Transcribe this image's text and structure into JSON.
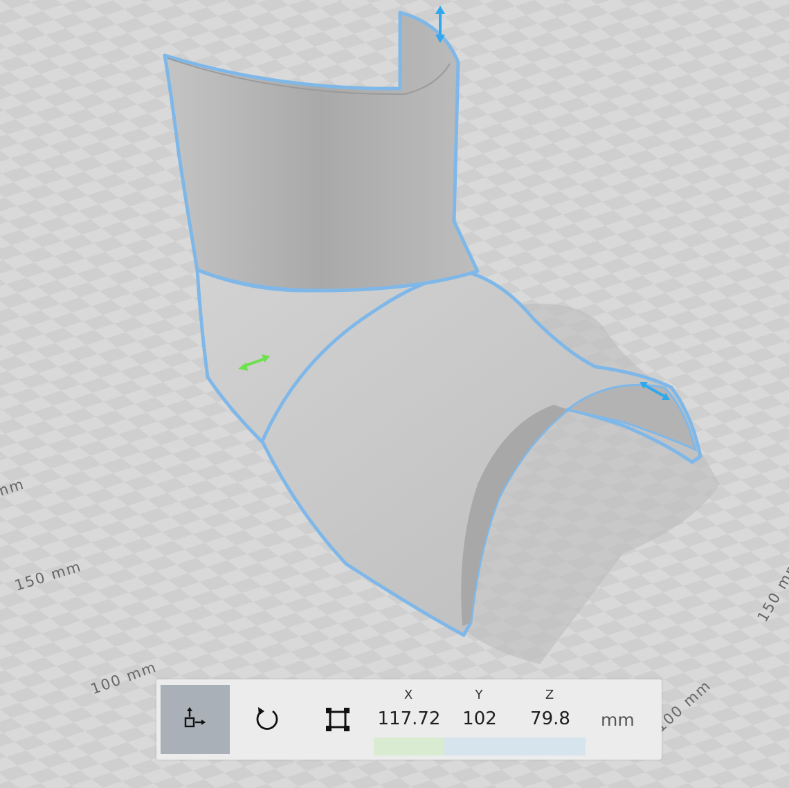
{
  "viewport": {
    "axis_labels": [
      "150 mm",
      "100 mm",
      "150 mm",
      "100 mm",
      "mm"
    ]
  },
  "toolbar": {
    "tools": [
      {
        "name": "move-tool",
        "icon": "move-icon",
        "active": true
      },
      {
        "name": "rotate-tool",
        "icon": "rotate-icon",
        "active": false
      },
      {
        "name": "scale-tool",
        "icon": "scale-icon",
        "active": false
      }
    ],
    "coords": {
      "x_label": "X",
      "y_label": "Y",
      "z_label": "Z",
      "x_value": "117.72",
      "y_value": "102",
      "z_value": "79.8"
    },
    "unit": "mm"
  },
  "colors": {
    "selection_outline": "#7fb8e8",
    "x_handle": "#6ee04e",
    "y_handle": "#2fa8ee",
    "z_handle": "#2fa8ee",
    "active_tool_bg": "#a9b0b8",
    "x_bar": "#d9ecd2",
    "yz_bar": "#d6e4ee"
  }
}
